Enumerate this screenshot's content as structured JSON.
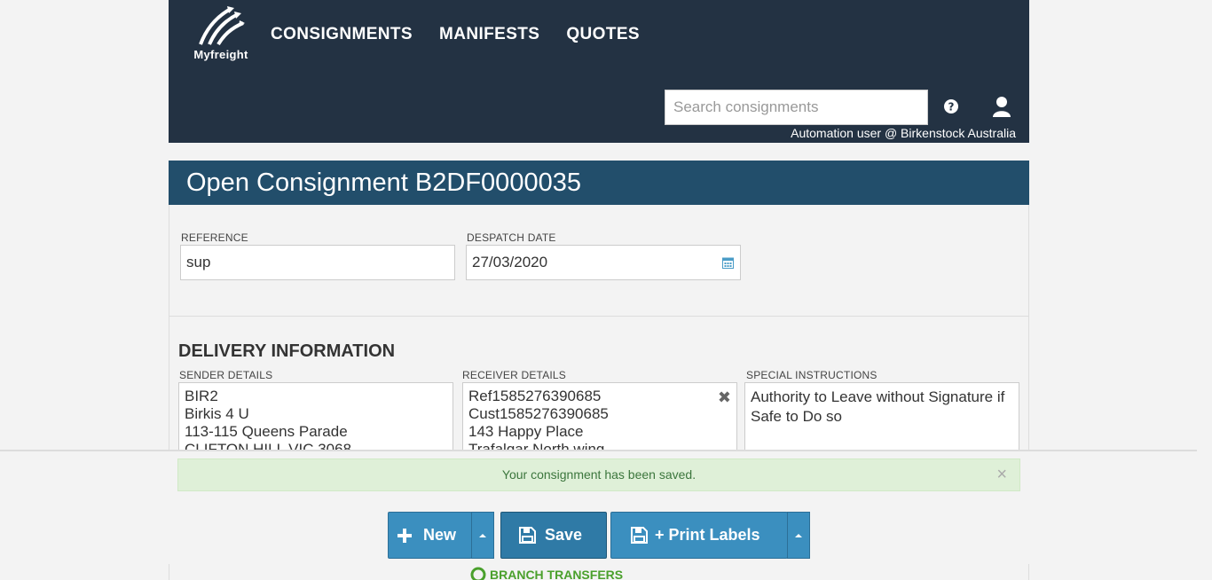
{
  "header": {
    "logo_text": "Myfreight",
    "nav": [
      {
        "label": "CONSIGNMENTS"
      },
      {
        "label": "MANIFESTS"
      },
      {
        "label": "QUOTES"
      }
    ],
    "search": {
      "placeholder": "Search consignments",
      "value": ""
    },
    "user_line": "Automation user @ Birkenstock Australia"
  },
  "page": {
    "title": "Open Consignment B2DF0000035"
  },
  "form": {
    "reference": {
      "label": "REFERENCE",
      "value": "sup"
    },
    "despatch_date": {
      "label": "DESPATCH DATE",
      "value": "27/03/2020"
    }
  },
  "delivery": {
    "title": "DELIVERY INFORMATION",
    "sender": {
      "label": "SENDER DETAILS",
      "lines": [
        "BIR2",
        "Birkis 4 U",
        "113-115 Queens Parade",
        "CLIFTON HILL VIC 3068"
      ]
    },
    "receiver": {
      "label": "RECEIVER DETAILS",
      "lines": [
        "Ref1585276390685",
        "Cust1585276390685",
        "143 Happy Place",
        "Trafalgar North wing"
      ]
    },
    "instructions": {
      "label": "SPECIAL INSTRUCTIONS",
      "text": "Authority to Leave without Signature if Safe to Do so"
    }
  },
  "footer": {
    "alert": "Your consignment has been saved.",
    "buttons": {
      "new": "New",
      "save": "Save",
      "print": "+ Print Labels"
    },
    "branch_transfers": "BRANCH TRANSFERS"
  },
  "colors": {
    "header_bg": "#233243",
    "title_bg": "#224e6b",
    "button_bg": "#3b8fbf",
    "alert_bg": "#dff0d8",
    "alert_text": "#3c763d",
    "branch_green": "#4aa02c"
  }
}
